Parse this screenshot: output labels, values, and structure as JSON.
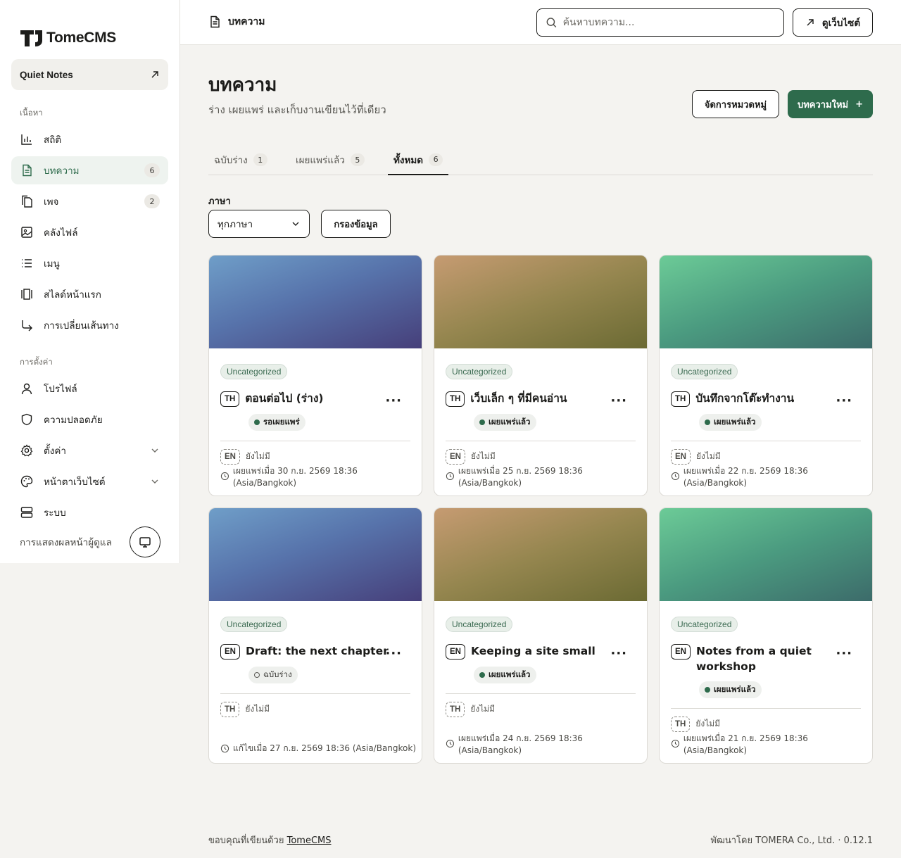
{
  "brand": {
    "name": "TomeCMS"
  },
  "site_switcher": {
    "name": "Quiet Notes"
  },
  "sidebar": {
    "content_label": "เนื้อหา",
    "settings_label": "การตั้งค่า",
    "content_items": [
      {
        "label": "สถิติ",
        "icon": "stats-icon"
      },
      {
        "label": "บทความ",
        "icon": "article-icon",
        "count": "6",
        "active": true
      },
      {
        "label": "เพจ",
        "icon": "pages-icon",
        "count": "2"
      },
      {
        "label": "คลังไฟล์",
        "icon": "image-icon"
      },
      {
        "label": "เมนู",
        "icon": "menu-list-icon"
      },
      {
        "label": "สไลด์หน้าแรก",
        "icon": "slides-icon"
      },
      {
        "label": "การเปลี่ยนเส้นทาง",
        "icon": "redirect-icon"
      }
    ],
    "settings_items": [
      {
        "label": "โปรไฟล์",
        "icon": "user-icon"
      },
      {
        "label": "ความปลอดภัย",
        "icon": "shield-icon"
      },
      {
        "label": "ตั้งค่า",
        "icon": "gear-icon",
        "expandable": true
      },
      {
        "label": "หน้าตาเว็บไซต์",
        "icon": "palette-icon",
        "expandable": true
      },
      {
        "label": "ระบบ",
        "icon": "server-icon"
      }
    ],
    "admin_view_label": "การแสดงผลหน้าผู้ดูแล"
  },
  "topbar": {
    "title": "บทความ",
    "search_placeholder": "ค้นหาบทความ...",
    "view_site_label": "ดูเว็บไซต์"
  },
  "main": {
    "title": "บทความ",
    "subtitle": "ร่าง เผยแพร่ และเก็บงานเขียนไว้ที่เดียว",
    "manage_categories_label": "จัดการหมวดหมู่",
    "new_post_label": "บทความใหม่",
    "new_post_icon": "+",
    "tabs": [
      {
        "label": "ฉบับร่าง",
        "count": "1"
      },
      {
        "label": "เผยแพร่แล้ว",
        "count": "5"
      },
      {
        "label": "ทั้งหมด",
        "count": "6",
        "active": true
      }
    ],
    "language_label": "ภาษา",
    "language_value": "ทุกภาษา",
    "filter_label": "กรองข้อมูล"
  },
  "posts": [
    {
      "category": "Uncategorized",
      "lang": "TH",
      "title": "ตอนต่อไป (ร่าง)",
      "status": "รอเผยแพร่",
      "status_type": "pending",
      "trans_lang": "EN",
      "trans_status": "ยังไม่มี",
      "meta": "เผยแพร่เมื่อ 30 ก.ย. 2569 18:36 (Asia/Bangkok)",
      "cover": "blue"
    },
    {
      "category": "Uncategorized",
      "lang": "TH",
      "title": "เว็บเล็ก ๆ ที่มีคนอ่าน",
      "status": "เผยแพร่แล้ว",
      "status_type": "published",
      "trans_lang": "EN",
      "trans_status": "ยังไม่มี",
      "meta": "เผยแพร่เมื่อ 25 ก.ย. 2569 18:36 (Asia/Bangkok)",
      "cover": "olive"
    },
    {
      "category": "Uncategorized",
      "lang": "TH",
      "title": "บันทึกจากโต๊ะทำงาน",
      "status": "เผยแพร่แล้ว",
      "status_type": "published",
      "trans_lang": "EN",
      "trans_status": "ยังไม่มี",
      "meta": "เผยแพร่เมื่อ 22 ก.ย. 2569 18:36 (Asia/Bangkok)",
      "cover": "green"
    },
    {
      "category": "Uncategorized",
      "lang": "EN",
      "title": "Draft: the next chapter",
      "status": "ฉบับร่าง",
      "status_type": "draft",
      "trans_lang": "TH",
      "trans_status": "ยังไม่มี",
      "meta": "แก้ไขเมื่อ 27 ก.ย. 2569 18:36 (Asia/Bangkok)",
      "cover": "blue"
    },
    {
      "category": "Uncategorized",
      "lang": "EN",
      "title": "Keeping a site small",
      "status": "เผยแพร่แล้ว",
      "status_type": "published",
      "trans_lang": "TH",
      "trans_status": "ยังไม่มี",
      "meta": "เผยแพร่เมื่อ 24 ก.ย. 2569 18:36 (Asia/Bangkok)",
      "cover": "olive"
    },
    {
      "category": "Uncategorized",
      "lang": "EN",
      "title": "Notes from a quiet workshop",
      "status": "เผยแพร่แล้ว",
      "status_type": "published",
      "trans_lang": "TH",
      "trans_status": "ยังไม่มี",
      "meta": "เผยแพร่เมื่อ 21 ก.ย. 2569 18:36 (Asia/Bangkok)",
      "cover": "green"
    }
  ],
  "footer": {
    "thanks_text": "ขอบคุณที่เขียนด้วย",
    "thanks_link": "TomeCMS",
    "credit": "พัฒนาโดย TOMERA Co., Ltd. · 0.12.1"
  },
  "colors": {
    "accent": "#2e6b4c",
    "active_nav_bg": "#eef3ef",
    "page_bg": "#f4f3f0"
  }
}
